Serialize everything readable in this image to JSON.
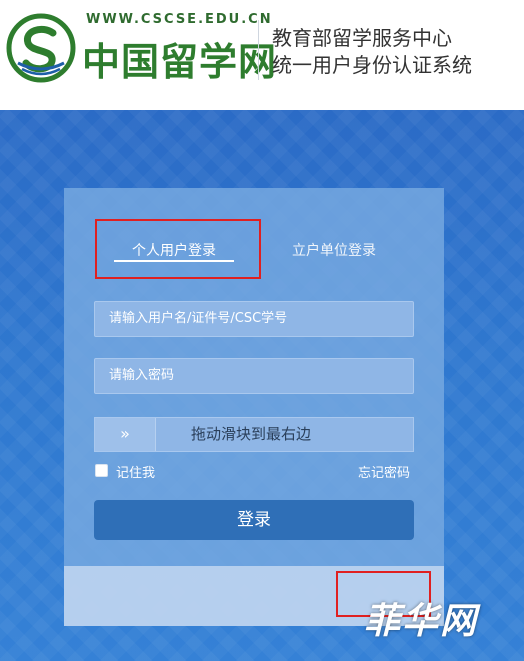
{
  "header": {
    "logo_url": "WWW.CSCSE.EDU.CN",
    "logo_cn": "中国留学网",
    "org_line1": "教育部留学服务中心",
    "org_line2": "统一用户身份认证系统"
  },
  "login": {
    "tab_personal": "个人用户登录",
    "tab_unit": "立户单位登录",
    "username_placeholder": "请输入用户名/证件号/CSC学号",
    "password_placeholder": "请输入密码",
    "slider_handle": "»",
    "slider_text": "拖动滑块到最右边",
    "remember": "记住我",
    "forgot": "忘记密码",
    "submit": "登录"
  },
  "watermark": "菲华网",
  "colors": {
    "brand_green": "#2e7d2e",
    "background_blue": "#2f78cf",
    "button_blue": "#2f6fb7",
    "highlight_red": "#e02020"
  },
  "icons": [
    "logo-mark",
    "double-chevron-right-icon",
    "checkbox-icon"
  ]
}
